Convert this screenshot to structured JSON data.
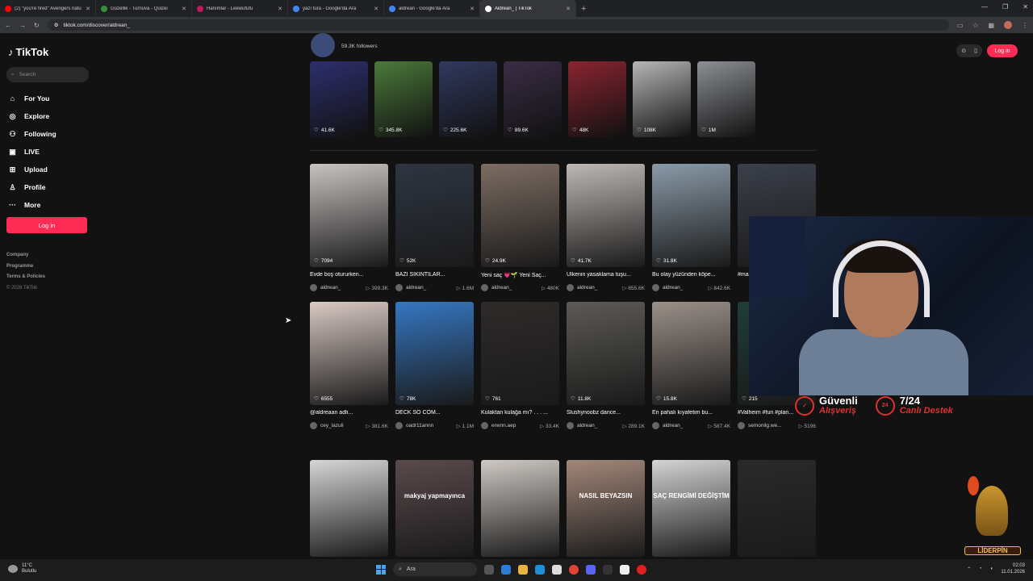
{
  "browser": {
    "tabs": [
      {
        "label": "(2) \"you're fired\" Avengers natu",
        "color": "#ff0000"
      },
      {
        "label": "Güzellik - Turnuva - Quizei",
        "color": "#3b8c3b"
      },
      {
        "label": "Hanımlar - Leewufufu",
        "color": "#c2185b"
      },
      {
        "label": "yazı tura - Google'da Ara",
        "color": "#4285f4"
      },
      {
        "label": "aldrean - Google'da Ara",
        "color": "#4285f4"
      },
      {
        "label": "Aldrean_ | TikTok",
        "color": "#ffffff"
      }
    ],
    "url": "tiktok.com/discover/aldrean_"
  },
  "sidebar": {
    "logo": "TikTok",
    "search_placeholder": "Search",
    "nav": [
      {
        "icon": "⌂",
        "label": "For You"
      },
      {
        "icon": "◎",
        "label": "Explore"
      },
      {
        "icon": "⚇",
        "label": "Following"
      },
      {
        "icon": "▣",
        "label": "LIVE"
      },
      {
        "icon": "⊞",
        "label": "Upload"
      },
      {
        "icon": "♙",
        "label": "Profile"
      },
      {
        "icon": "···",
        "label": "More"
      }
    ],
    "login": "Log in",
    "footer": [
      "Company",
      "Programme",
      "Terms & Policies"
    ],
    "copyright": "© 2026 TikTok"
  },
  "topbar": {
    "login": "Log in"
  },
  "profile": {
    "followers": "59.3K followers"
  },
  "stories": [
    {
      "likes": "41.6K",
      "color": "#2d2f6e"
    },
    {
      "likes": "345.8K",
      "color": "#4b7a3a"
    },
    {
      "likes": "225.6K",
      "color": "#31395f"
    },
    {
      "likes": "89.6K",
      "color": "#3a2d46"
    },
    {
      "likes": "48K",
      "color": "#8a2430"
    },
    {
      "likes": "108K",
      "color": "#b7b7b7"
    },
    {
      "likes": "1M",
      "color": "#8d8f94"
    }
  ],
  "row1": [
    {
      "likes": "7094",
      "caption": "Evde boş otururken...",
      "user": "aldrean_",
      "plays": "399.3K",
      "color": "#c7c3c1"
    },
    {
      "likes": "52K",
      "caption": "BAZI SIKINTILAR...",
      "user": "aldrean_",
      "plays": "1.6M",
      "color": "#2e3542"
    },
    {
      "likes": "24.9K",
      "caption": "Yeni saç 💗🌱 Yeni Saç...",
      "user": "aldrean_",
      "plays": "480K",
      "color": "#7d6d63"
    },
    {
      "likes": "41.7K",
      "caption": "Ülkenin yasaklama tuşu...",
      "user": "aldrean_",
      "plays": "855.6K",
      "color": "#bdb8b4"
    },
    {
      "likes": "31.8K",
      "caption": "Bu olay yüzünden köpe...",
      "user": "aldrean_",
      "plays": "842.6K",
      "color": "#8a9aa8"
    },
    {
      "likes": "",
      "caption": "#ma",
      "user": "",
      "plays": "",
      "color": "#3a3f4a"
    }
  ],
  "row2": [
    {
      "likes": "6555",
      "caption": "@aldreaan adlı...",
      "user": "cey_lazuli",
      "plays": "381.6K",
      "color": "#d9c9c3"
    },
    {
      "likes": "78K",
      "caption": "DECK SÓ COM...",
      "user": "oadr11annn",
      "plays": "1.1M",
      "color": "#3577c2"
    },
    {
      "likes": "761",
      "caption": "Kulaktan kulağa mı? . . . ...",
      "user": "erwnn.aep",
      "plays": "33.4K",
      "color": "#2e2a2a"
    },
    {
      "likes": "11.8K",
      "caption": "Slushynoobz dance...",
      "user": "aldrean_",
      "plays": "289.1K",
      "color": "#5c5a55"
    },
    {
      "likes": "15.8K",
      "caption": "En pahalı kıyafetim bu...",
      "user": "aldrean_",
      "plays": "587.4K",
      "color": "#9b9089"
    },
    {
      "likes": "215",
      "caption": "#Valheim #fun #plan...",
      "user": "semonilg.we...",
      "plays": "5196",
      "color": "#1f3d3a"
    }
  ],
  "row3": [
    {
      "overlay": "",
      "color": "#d6d6d6"
    },
    {
      "overlay": "makyaj yapmayınca",
      "color": "#5a4a4c"
    },
    {
      "overlay": "",
      "color": "#cfc9c4"
    },
    {
      "overlay": "NASIL BEYAZSIN",
      "color": "#a3877a"
    },
    {
      "overlay": "SAÇ RENGİMİ DEĞİŞTİM",
      "color": "#d4d4d4"
    },
    {
      "overlay": "",
      "color": "#2a2a2a"
    }
  ],
  "stream": {
    "promo1_title": "Güvenli",
    "promo1_sub": "Alışveriş",
    "promo2_title": "7/24",
    "promo2_sub": "Canlı Destek",
    "brand": "LİDERPİN",
    "accent": "#e0312f"
  },
  "taskbar": {
    "weather_temp": "11°C",
    "weather_desc": "Bulutlu",
    "search": "Ara",
    "time": "02:03",
    "date": "11.01.2026"
  }
}
